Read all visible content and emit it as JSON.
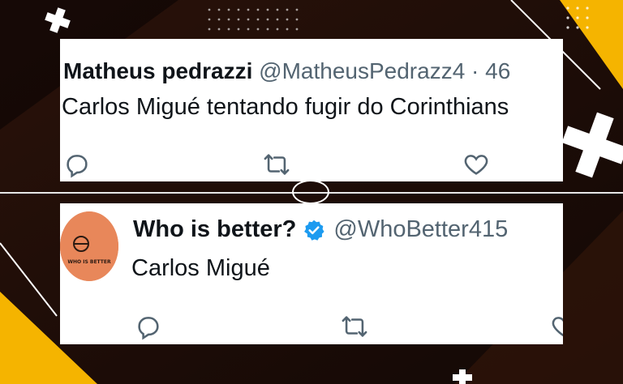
{
  "tweet1": {
    "display_name": "Matheus pedrazzi",
    "handle": "@MatheusPedrazz4 · 46",
    "text": "Carlos Migué tentando fugir do Corinthians"
  },
  "tweet2": {
    "display_name": "Who is better?",
    "handle": "@WhoBetter415",
    "text": "Carlos Migué",
    "avatar_text": "WHO IS BETTER",
    "verified": true
  },
  "icons": [
    "reply-icon",
    "retweet-icon",
    "like-icon",
    "verified-icon"
  ],
  "colors": {
    "background": "#1a0c06",
    "accent_yellow": "#f5b400",
    "verified_blue": "#1d9bf0",
    "icon_gray": "#536471",
    "avatar_orange": "#e8875a"
  }
}
